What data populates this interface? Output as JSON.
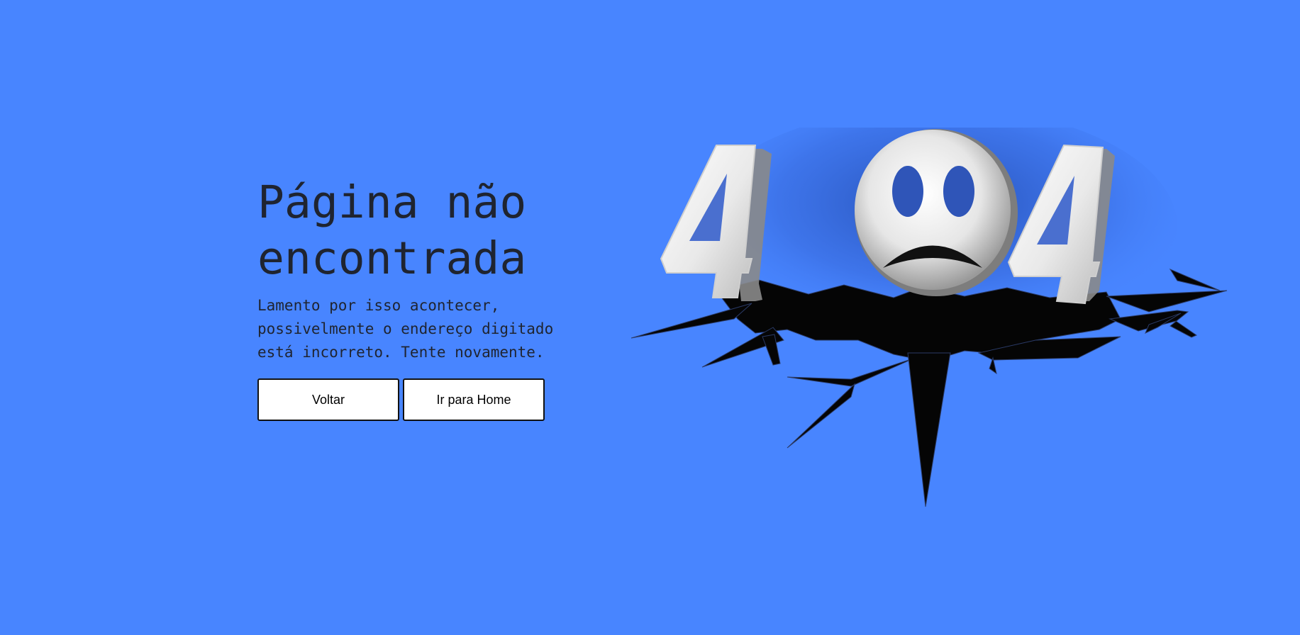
{
  "page": {
    "background_color": "#4885ff",
    "title_lines": [
      "Página não",
      "encontrada"
    ],
    "description_lines": [
      "Lamento por isso acontecer,",
      "possivelmente o endereço digitado",
      "está incorreto. Tente novamente."
    ]
  },
  "actions": {
    "back_label": "Voltar",
    "home_label": "Ir para Home"
  },
  "illustration": {
    "icon": "404-cracked-illustration",
    "text": "404"
  }
}
